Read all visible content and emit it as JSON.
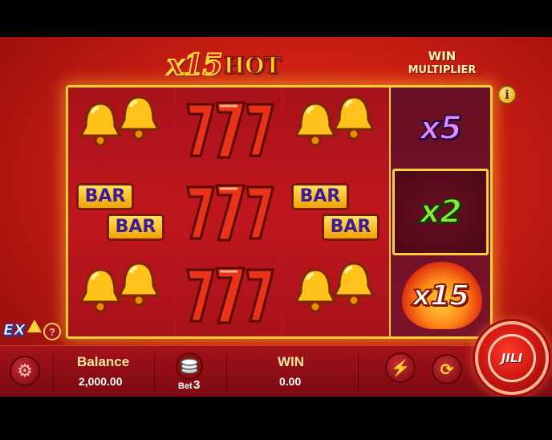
{
  "logo": {
    "multiplier_text": "x15",
    "hot_text": "HOT"
  },
  "win_multiplier": {
    "line1": "WIN",
    "line2": "MULTIPLIER"
  },
  "info_button": {
    "icon": "info-icon",
    "label": "i"
  },
  "reels": {
    "symbols": [
      [
        "bell",
        "seven",
        "bell"
      ],
      [
        "bar",
        "seven",
        "bar"
      ],
      [
        "bell",
        "seven",
        "bell"
      ]
    ],
    "bar_label": "BAR"
  },
  "multipliers": [
    {
      "label": "x5",
      "active": false
    },
    {
      "label": "x2",
      "active": true
    },
    {
      "label": "x15",
      "active": false,
      "flaming": true
    }
  ],
  "extra_bet": {
    "label": "EX",
    "help": "?"
  },
  "bottom_bar": {
    "settings_icon": "gear-icon",
    "balance_label": "Balance",
    "balance_value": "2,000.00",
    "bet_icon": "chip-stack-icon",
    "bet_label": "Bet",
    "bet_value": "3",
    "win_label": "WIN",
    "win_value": "0.00",
    "turbo_icon": "lightning-icon",
    "auto_icon": "autoplay-icon"
  },
  "spin_button": {
    "label": "JILI"
  },
  "colors": {
    "background": "#c81d12",
    "frame_gold": "#ffcf33",
    "x5": "#e08bff",
    "x2": "#8aea3a",
    "bar_text": "#3c1a9a"
  }
}
